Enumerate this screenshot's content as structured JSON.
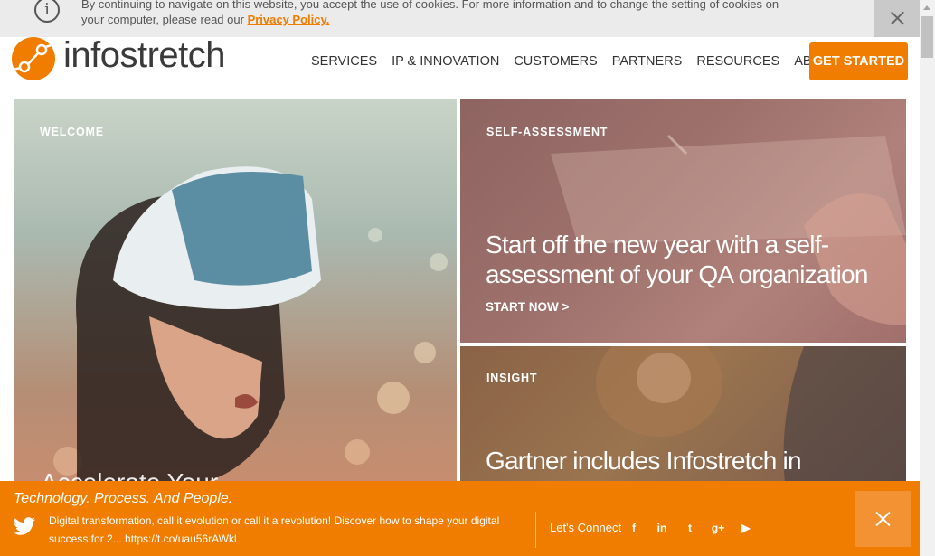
{
  "cookie": {
    "icon": "info-icon",
    "text": "By continuing to navigate on this website, you accept the use of cookies. For more information and to change the setting of cookies on your computer, please read our ",
    "link": "Privacy Policy.",
    "close_icon": "close-icon"
  },
  "header": {
    "logo_text": "infostretch",
    "nav": [
      "SERVICES",
      "IP & INNOVATION",
      "CUSTOMERS",
      "PARTNERS",
      "RESOURCES",
      "ABOUT"
    ],
    "cta": "GET STARTED"
  },
  "tiles": {
    "welcome": {
      "label": "WELCOME",
      "partial_title": "Accelerate Your"
    },
    "assessment": {
      "label": "SELF-ASSESSMENT",
      "title": "Start off the new year with a self-assessment of your QA organization",
      "link": "START NOW >"
    },
    "insight": {
      "label": "INSIGHT",
      "title": "Gartner includes Infostretch in"
    }
  },
  "promo": {
    "title": "Technology. Process. And People.",
    "tweet": "Digital transformation, call it evolution or call it a revolution! Discover how to shape your digital success for 2... https://t.co/uau56rAWkl",
    "connect_label": "Let's Connect",
    "social": [
      "facebook-icon",
      "linkedin-icon",
      "twitter-icon",
      "googleplus-icon",
      "youtube-icon"
    ],
    "social_glyphs": [
      "f",
      "in",
      "t",
      "g+",
      "▶"
    ]
  },
  "colors": {
    "accent": "#f07d00",
    "cookie_bg": "#ebebeb"
  }
}
